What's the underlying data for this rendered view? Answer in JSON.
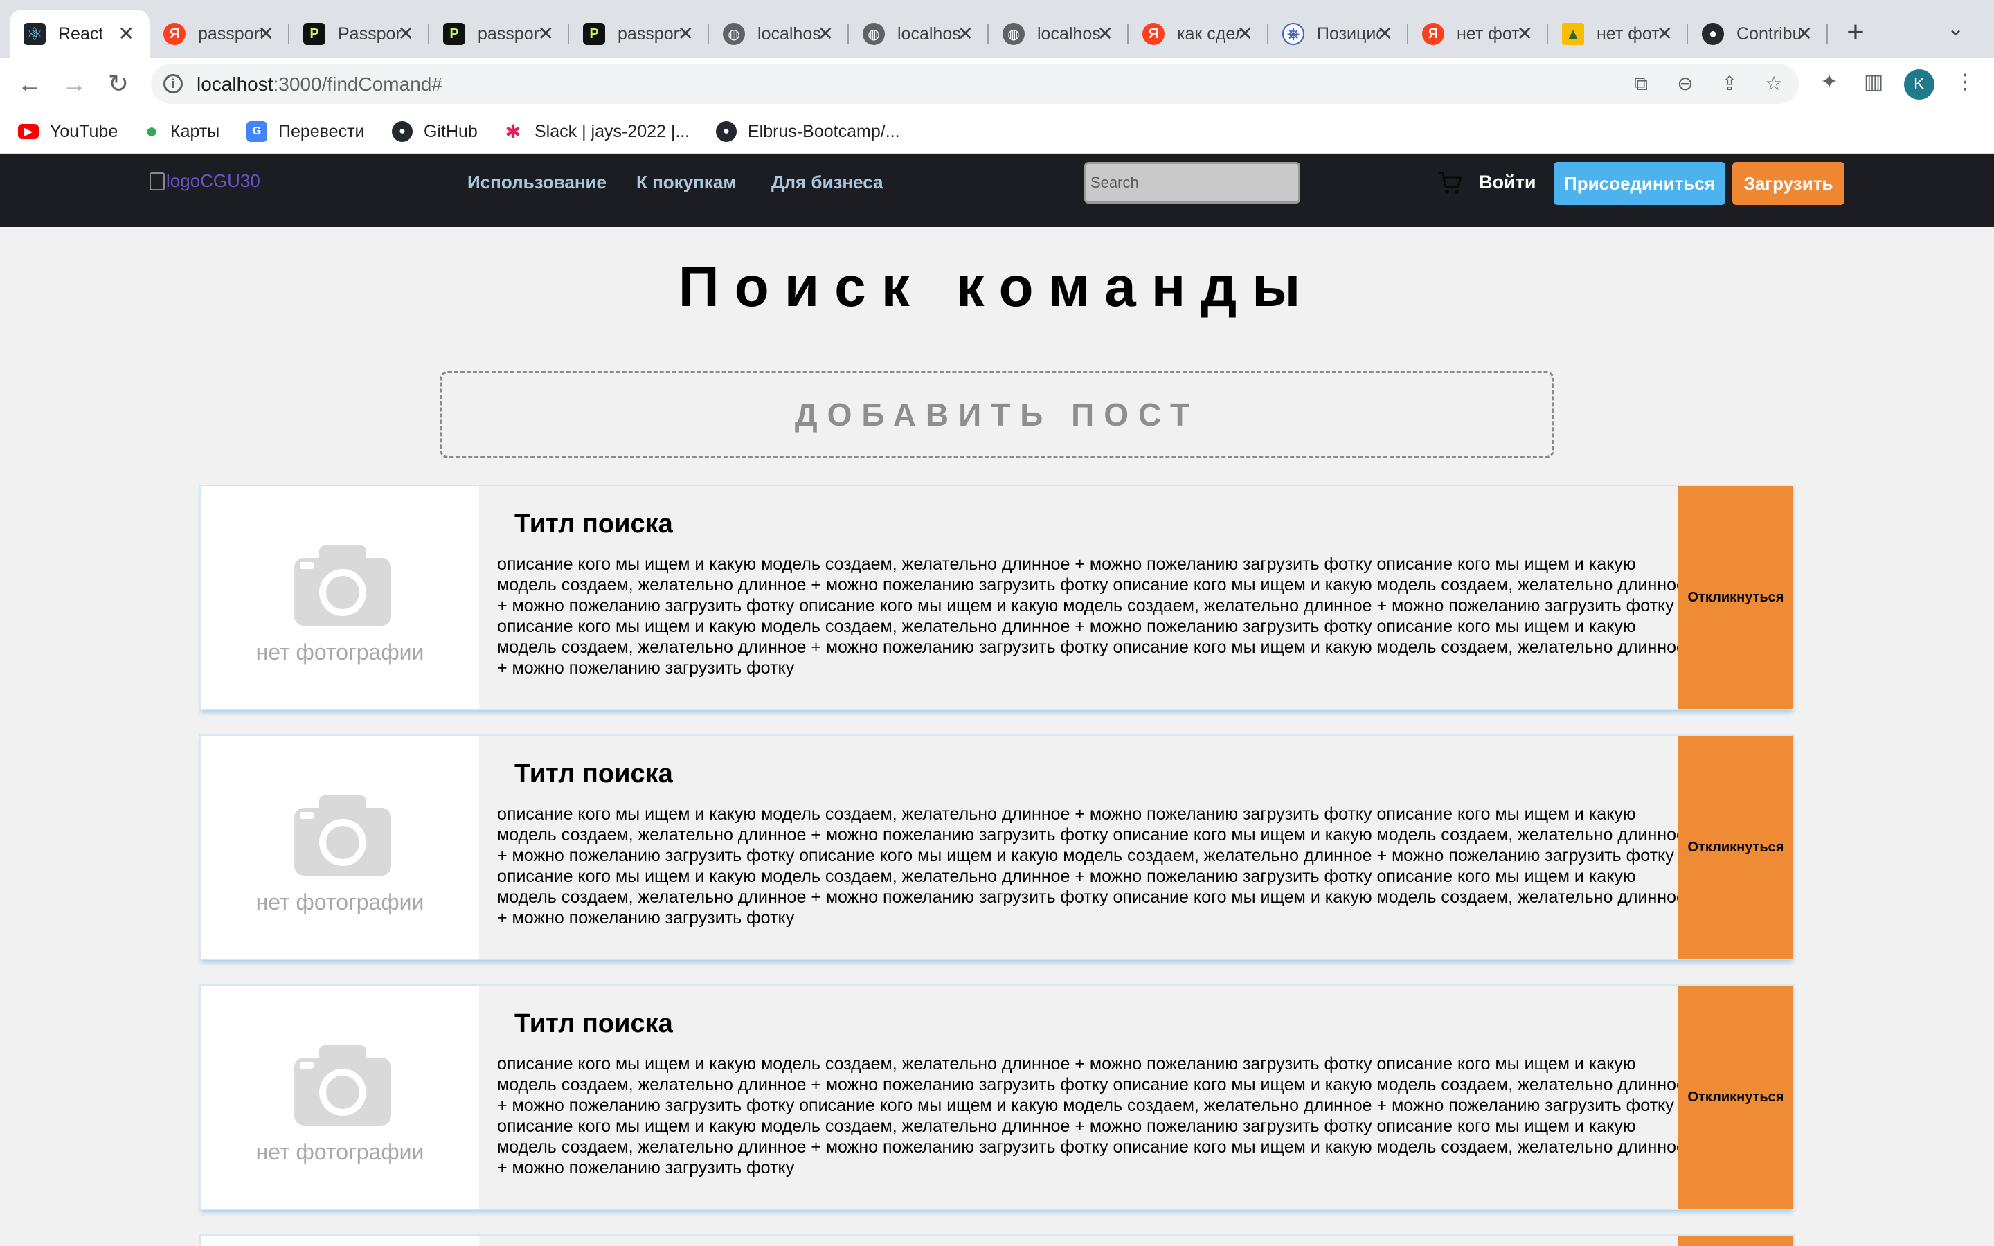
{
  "browser": {
    "tabs": [
      {
        "title": "React",
        "icon": "react-icon"
      },
      {
        "title": "passport",
        "icon": "yandex-icon"
      },
      {
        "title": "Passport",
        "icon": "passport-js-icon"
      },
      {
        "title": "passport",
        "icon": "passport-js-icon"
      },
      {
        "title": "passport",
        "icon": "passport-js-icon"
      },
      {
        "title": "localhost",
        "icon": "globe-icon"
      },
      {
        "title": "localhost",
        "icon": "globe-icon"
      },
      {
        "title": "localhost",
        "icon": "globe-icon"
      },
      {
        "title": "как сделать",
        "icon": "yandex-icon"
      },
      {
        "title": "Позиционирование",
        "icon": "kubernetes-icon"
      },
      {
        "title": "нет фото",
        "icon": "yandex-icon"
      },
      {
        "title": "нет фото",
        "icon": "image-icon"
      },
      {
        "title": "Contribute",
        "icon": "github-icon"
      }
    ],
    "url_host": "localhost",
    "url_path": ":3000/findComand#",
    "profile_letter": "K",
    "bookmarks": [
      {
        "label": "YouTube",
        "icon": "youtube-icon",
        "color": "#ff0000"
      },
      {
        "label": "Карты",
        "icon": "maps-icon",
        "color": "#34a853"
      },
      {
        "label": "Перевести",
        "icon": "translate-icon",
        "color": "#4285f4"
      },
      {
        "label": "GitHub",
        "icon": "github-icon",
        "color": "#24292f"
      },
      {
        "label": "Slack | jays-2022 |...",
        "icon": "slack-icon",
        "color": "#e01e5a"
      },
      {
        "label": "Elbrus-Bootcamp/...",
        "icon": "github-icon",
        "color": "#24292f"
      }
    ]
  },
  "site": {
    "logo_alt": "logoCGU30",
    "nav": [
      "Использование",
      "К покупкам",
      "Для бизнеса"
    ],
    "search_placeholder": "Search",
    "login": "Войти",
    "join": "Присоединиться",
    "upload": "Загрузить",
    "colors": {
      "header_bg": "#1c1c23",
      "join": "#4cb3ee",
      "upload": "#f08833",
      "respond": "#f08b35"
    }
  },
  "page": {
    "title": "Поиск команды",
    "add_post": "ДОБАВИТЬ ПОСТ",
    "posts": [
      {
        "title": "Титл поиска",
        "photo_placeholder": "нет фотографии",
        "description": "описание кого мы ищем и какую модель создаем, желательно длинное + можно пожеланию загрузить фотку описание кого мы ищем и какую модель создаем, желательно длинное + можно пожеланию загрузить фотку описание кого мы ищем и какую модель создаем, желательно длинное + можно пожеланию загрузить фотку описание кого мы ищем и какую модель создаем, желательно длинное + можно пожеланию загрузить фотку описание кого мы ищем и какую модель создаем, желательно длинное + можно пожеланию загрузить фотку описание кого мы ищем и какую модель создаем, желательно длинное + можно пожеланию загрузить фотку описание кого мы ищем и какую модель создаем, желательно длинное + можно пожеланию загрузить фотку",
        "button": "Откликнуться"
      },
      {
        "title": "Титл поиска",
        "photo_placeholder": "нет фотографии",
        "description": "описание кого мы ищем и какую модель создаем, желательно длинное + можно пожеланию загрузить фотку описание кого мы ищем и какую модель создаем, желательно длинное + можно пожеланию загрузить фотку описание кого мы ищем и какую модель создаем, желательно длинное + можно пожеланию загрузить фотку описание кого мы ищем и какую модель создаем, желательно длинное + можно пожеланию загрузить фотку описание кого мы ищем и какую модель создаем, желательно длинное + можно пожеланию загрузить фотку описание кого мы ищем и какую модель создаем, желательно длинное + можно пожеланию загрузить фотку описание кого мы ищем и какую модель создаем, желательно длинное + можно пожеланию загрузить фотку",
        "button": "Откликнуться"
      },
      {
        "title": "Титл поиска",
        "photo_placeholder": "нет фотографии",
        "description": "описание кого мы ищем и какую модель создаем, желательно длинное + можно пожеланию загрузить фотку описание кого мы ищем и какую модель создаем, желательно длинное + можно пожеланию загрузить фотку описание кого мы ищем и какую модель создаем, желательно длинное + можно пожеланию загрузить фотку описание кого мы ищем и какую модель создаем, желательно длинное + можно пожеланию загрузить фотку описание кого мы ищем и какую модель создаем, желательно длинное + можно пожеланию загрузить фотку описание кого мы ищем и какую модель создаем, желательно длинное + можно пожеланию загрузить фотку описание кого мы ищем и какую модель создаем, желательно длинное + можно пожеланию загрузить фотку",
        "button": "Откликнуться"
      }
    ]
  }
}
